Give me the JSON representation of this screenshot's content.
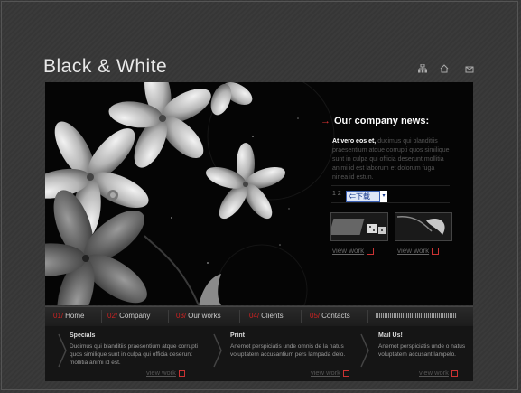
{
  "header": {
    "title": "Black & White"
  },
  "news": {
    "title": "Our company news:",
    "lead": "At vero eos et,",
    "body": "ducimus qui blanditiis praesentium atque corrupti quos similique sunt in culpa qui officia deserunt mollitia animi id est laborum et dolorum fuga ninea id estun.",
    "pager": "1 2",
    "ime_label": "下载",
    "view_work": "view work"
  },
  "nav": {
    "items": [
      {
        "num": "01/",
        "label": "Home"
      },
      {
        "num": "02/",
        "label": "Company"
      },
      {
        "num": "03/",
        "label": "Our works"
      },
      {
        "num": "04/",
        "label": "Clients"
      },
      {
        "num": "05/",
        "label": "Contacts"
      }
    ]
  },
  "boxes": [
    {
      "title": "Specials",
      "text": "Ducimus qui blanditiis praesentium atque corrupti quos similique sunt in culpa qui officia deserunt mollitia animi id est.",
      "link": "view work"
    },
    {
      "title": "Print",
      "text": "Anemot perspiciatis unde omnis de la natus voluptatem accusantium pers lampada delo.",
      "link": "view work"
    },
    {
      "title": "Mail Us!",
      "text": "Anemot perspiciatis unde o natus voluptatem accusant lampelo.",
      "link": "view work"
    }
  ],
  "icons": [
    "sitemap-icon",
    "home-icon",
    "mail-icon"
  ],
  "colors": {
    "accent": "#cc2222",
    "background": "#383838"
  }
}
